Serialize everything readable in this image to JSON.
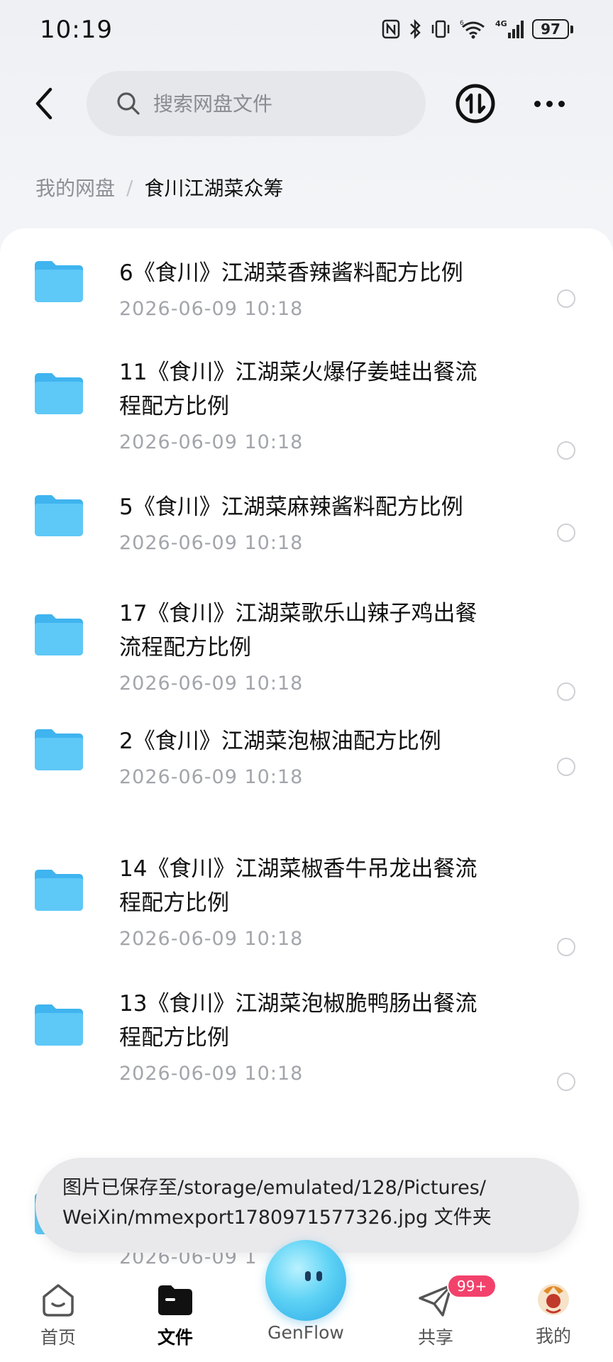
{
  "status_bar": {
    "time": "10:19",
    "battery": "97",
    "icons": [
      "nfc-icon",
      "bluetooth-icon",
      "vibrate-icon",
      "wifi-6-icon",
      "signal-4g-icon",
      "battery-icon"
    ]
  },
  "header": {
    "search_placeholder": "搜索网盘文件",
    "icons": [
      "back-arrow-icon",
      "search-icon",
      "transfer-icon",
      "more-icon"
    ]
  },
  "breadcrumb": {
    "root": "我的网盘",
    "separator": "/",
    "current": "食川江湖菜众筹"
  },
  "files": [
    {
      "name_line1": "6《食川》江湖菜香辣酱料配方比例",
      "name_line2": "",
      "date": "2026-06-09  10:18"
    },
    {
      "name_line1": "11《食川》江湖菜火爆仔姜蛙出餐流",
      "name_line2": "程配方比例",
      "date": "2026-06-09  10:18"
    },
    {
      "name_line1": "5《食川》江湖菜麻辣酱料配方比例",
      "name_line2": "",
      "date": "2026-06-09  10:18"
    },
    {
      "name_line1": "17《食川》江湖菜歌乐山辣子鸡出餐",
      "name_line2": "流程配方比例",
      "date": "2026-06-09  10:18"
    },
    {
      "name_line1": "2《食川》江湖菜泡椒油配方比例",
      "name_line2": "",
      "date": "2026-06-09  10:18"
    },
    {
      "name_line1": "14《食川》江湖菜椒香牛吊龙出餐流",
      "name_line2": "程配方比例",
      "date": "2026-06-09  10:18"
    },
    {
      "name_line1": "13《食川》江湖菜泡椒脆鸭肠出餐流",
      "name_line2": "程配方比例",
      "date": "2026-06-09  10:18"
    }
  ],
  "partial_row_date": "2026-06-09  1",
  "toast": {
    "line1": "图片已保存至/storage/emulated/128/Pictures/",
    "line2": "WeiXin/mmexport1780971577326.jpg 文件夹"
  },
  "bottom_nav": {
    "home": "首页",
    "files": "文件",
    "genflow": "GenFlow",
    "share": "共享",
    "mine": "我的",
    "share_badge": "99+"
  },
  "colors": {
    "folder": "#4fc0f5",
    "badge": "#f2426c",
    "date_text": "#a3a5ab"
  }
}
